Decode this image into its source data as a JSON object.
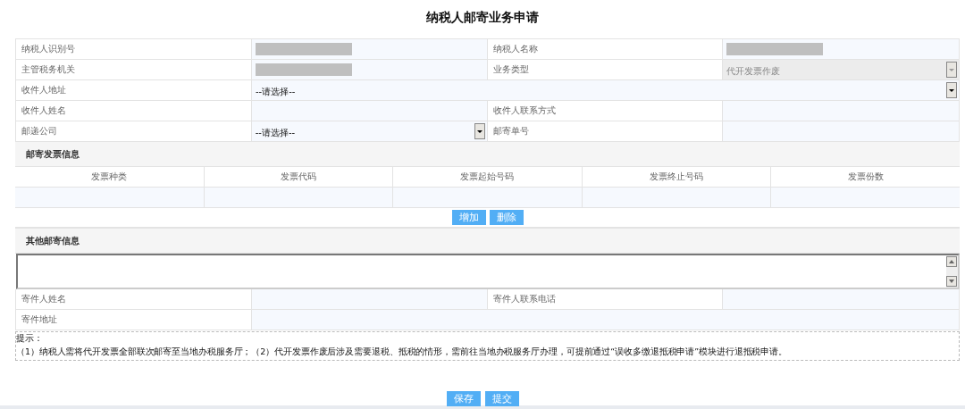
{
  "title": "纳税人邮寄业务申请",
  "form_rows": [
    {
      "cells": [
        {
          "kind": "label",
          "text": "纳税人识别号"
        },
        {
          "kind": "redacted"
        },
        {
          "kind": "label",
          "text": "纳税人名称"
        },
        {
          "kind": "redacted"
        }
      ]
    },
    {
      "cells": [
        {
          "kind": "label",
          "text": "主管税务机关"
        },
        {
          "kind": "redacted"
        },
        {
          "kind": "label",
          "text": "业务类型"
        },
        {
          "kind": "select",
          "value": "代开发票作废",
          "disabled": true
        }
      ]
    },
    {
      "cells": [
        {
          "kind": "label",
          "text": "收件人地址"
        },
        {
          "kind": "select",
          "value": "--请选择--",
          "disabled": false
        }
      ]
    },
    {
      "cells": [
        {
          "kind": "label",
          "text": "收件人姓名"
        },
        {
          "kind": "input"
        },
        {
          "kind": "label",
          "text": "收件人联系方式"
        },
        {
          "kind": "input"
        }
      ]
    },
    {
      "cells": [
        {
          "kind": "label",
          "text": "邮递公司"
        },
        {
          "kind": "select",
          "value": "--请选择--",
          "disabled": false
        },
        {
          "kind": "label",
          "text": "邮寄单号"
        },
        {
          "kind": "input"
        }
      ]
    }
  ],
  "invoice_section": {
    "heading": "邮寄发票信息",
    "columns": [
      "发票种类",
      "发票代码",
      "发票起始号码",
      "发票终止号码",
      "发票份数"
    ],
    "buttons": [
      "增加",
      "删除"
    ]
  },
  "other_section": {
    "heading": "其他邮寄信息"
  },
  "sender_rows": [
    {
      "cells": [
        {
          "kind": "label",
          "text": "寄件人姓名"
        },
        {
          "kind": "input"
        },
        {
          "kind": "label",
          "text": "寄件人联系电话"
        },
        {
          "kind": "input"
        }
      ]
    },
    {
      "cells": [
        {
          "kind": "label",
          "text": "寄件地址"
        },
        {
          "kind": "input"
        }
      ]
    }
  ],
  "tip": {
    "heading": "提示：",
    "text": "（1）纳税人需将代开发票全部联次邮寄至当地办税服务厅；（2）代开发票作废后涉及需要退税、抵税的情形，需前往当地办税服务厅办理，可提前通过“误收多缴退抵税申请”模块进行退抵税申请。"
  },
  "buttons": [
    "保存",
    "提交"
  ]
}
